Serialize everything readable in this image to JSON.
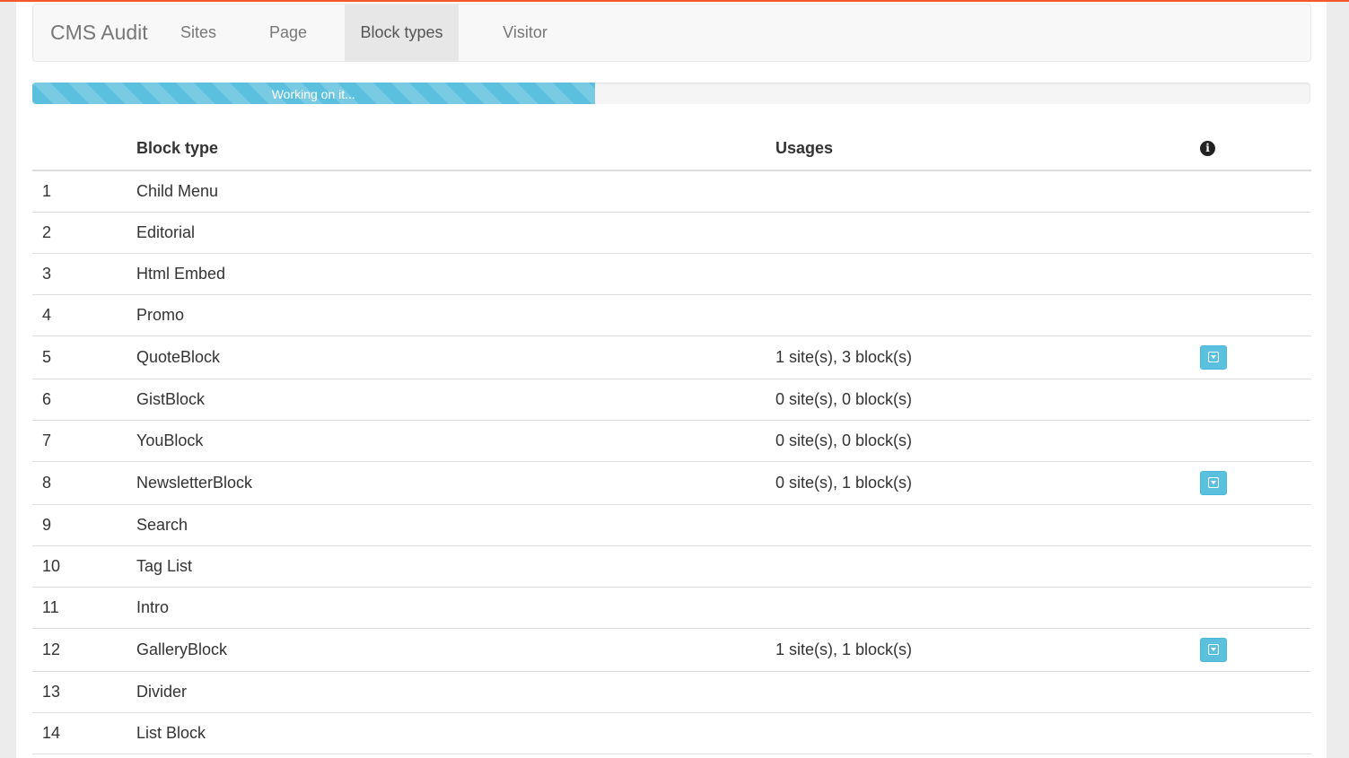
{
  "navbar": {
    "brand": "CMS Audit",
    "items": [
      {
        "label": "Sites"
      },
      {
        "label": "Page types"
      },
      {
        "label": "Block types",
        "active": true
      },
      {
        "label": "Visitor Groups"
      }
    ]
  },
  "progress": {
    "label": "Working on it...",
    "percent": 44,
    "color": "#5bc0de"
  },
  "table": {
    "headers": {
      "number": "",
      "block_type": "Block type",
      "usages": "Usages",
      "info_icon": "info-circle-icon"
    },
    "rows": [
      {
        "num": "1",
        "name": "Child Menu",
        "usages": "",
        "expand": false
      },
      {
        "num": "2",
        "name": "Editorial",
        "usages": "",
        "expand": false
      },
      {
        "num": "3",
        "name": "Html Embed",
        "usages": "",
        "expand": false
      },
      {
        "num": "4",
        "name": "Promo",
        "usages": "",
        "expand": false
      },
      {
        "num": "5",
        "name": "QuoteBlock",
        "usages": "1 site(s), 3 block(s)",
        "expand": true
      },
      {
        "num": "6",
        "name": "GistBlock",
        "usages": "0 site(s), 0 block(s)",
        "expand": false
      },
      {
        "num": "7",
        "name": "YouBlock",
        "usages": "0 site(s), 0 block(s)",
        "expand": false
      },
      {
        "num": "8",
        "name": "NewsletterBlock",
        "usages": "0 site(s), 1 block(s)",
        "expand": true
      },
      {
        "num": "9",
        "name": "Search",
        "usages": "",
        "expand": false
      },
      {
        "num": "10",
        "name": "Tag List",
        "usages": "",
        "expand": false
      },
      {
        "num": "11",
        "name": "Intro",
        "usages": "",
        "expand": false
      },
      {
        "num": "12",
        "name": "GalleryBlock",
        "usages": "1 site(s), 1 block(s)",
        "expand": true
      },
      {
        "num": "13",
        "name": "Divider",
        "usages": "",
        "expand": false
      },
      {
        "num": "14",
        "name": "List Block",
        "usages": "",
        "expand": false
      }
    ]
  },
  "colors": {
    "accent_top_line": "#f2582b",
    "button": "#5bc0de"
  }
}
